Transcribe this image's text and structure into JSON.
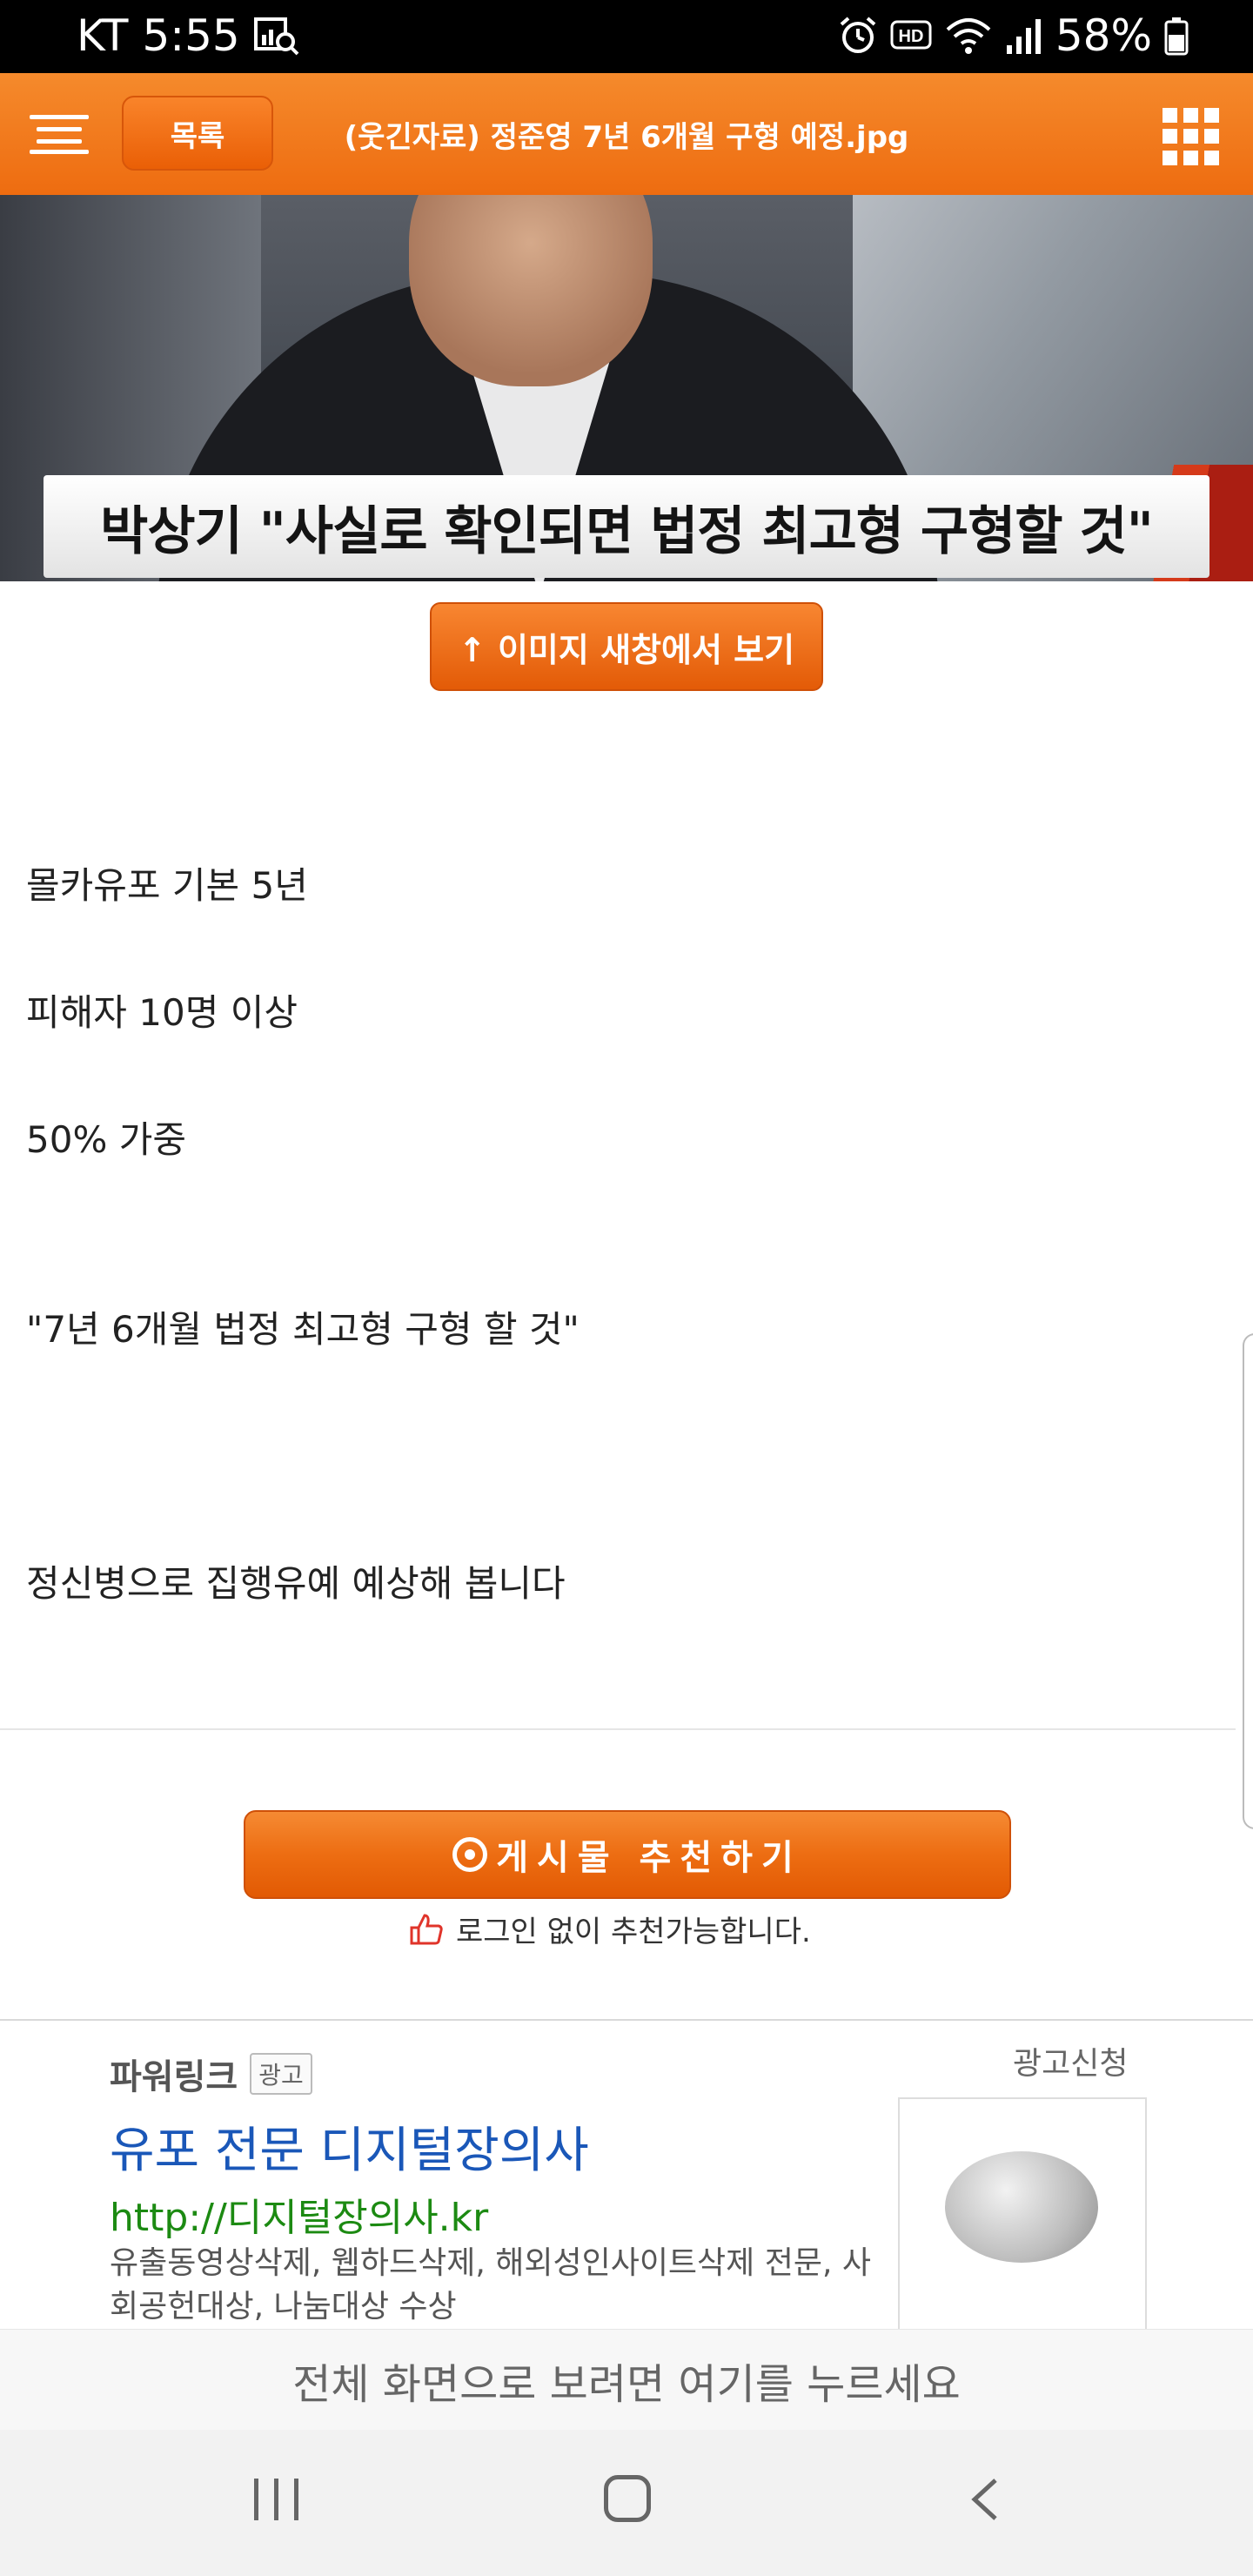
{
  "status_bar": {
    "carrier": "KT",
    "time": "5:55",
    "battery": "58%"
  },
  "header": {
    "list_button": "목록",
    "title": "(웃긴자료) 정준영 7년 6개월 구형 예정.jpg"
  },
  "image": {
    "caption": "박상기 \"사실로 확인되면 법정 최고형 구형할 것\""
  },
  "new_window_button": "↑ 이미지 새창에서 보기",
  "post": {
    "lines": [
      "몰카유포 기본 5년",
      "피해자 10명 이상",
      "50% 가중",
      "\"7년 6개월 법정 최고형 구형 할 것\"",
      "정신병으로 집행유예 예상해 봅니다"
    ]
  },
  "recommend": {
    "button": "게시물 추천하기",
    "note": "로그인 없이 추천가능합니다."
  },
  "ad": {
    "label": "파워링크",
    "badge": "광고",
    "apply": "광고신청",
    "title": "유포 전문 디지털장의사",
    "url": "http://디지털장의사.kr",
    "description": "유출동영상삭제, 웹하드삭제, 해외성인사이트삭제 전문, 사회공헌대상, 나눔대상 수상"
  },
  "fullscreen_bar": "전체 화면으로 보려면 여기를 누르세요",
  "colors": {
    "accent": "#ee6c10",
    "ad_title": "#1a57b8",
    "ad_url": "#1c8a12"
  }
}
